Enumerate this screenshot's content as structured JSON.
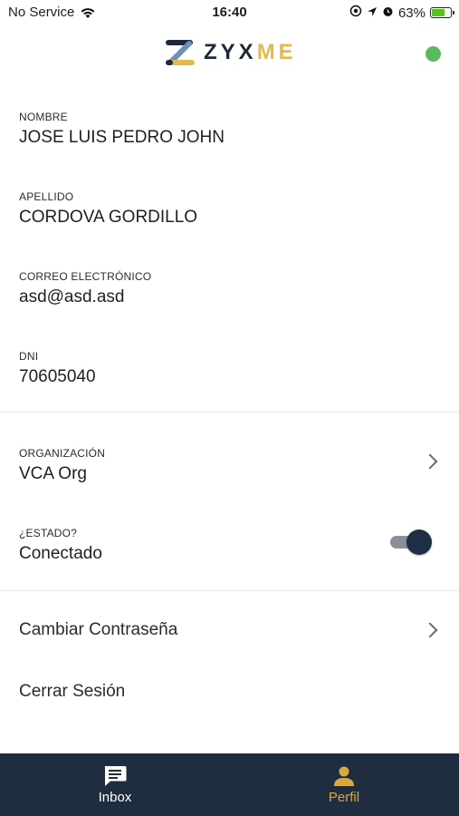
{
  "status_bar": {
    "carrier": "No Service",
    "time": "16:40",
    "battery": "63%"
  },
  "header": {
    "logo_text_left": "ZYX",
    "logo_text_right": "ME",
    "status_color": "#5cb85c"
  },
  "profile": {
    "nombre_label": "NOMBRE",
    "nombre_value": "JOSE LUIS PEDRO JOHN",
    "apellido_label": "APELLIDO",
    "apellido_value": "CORDOVA GORDILLO",
    "correo_label": "CORREO ELECTRÓNICO",
    "correo_value": "asd@asd.asd",
    "dni_label": "DNI",
    "dni_value": "70605040"
  },
  "organization": {
    "label": "ORGANIZACIÓN",
    "value": "VCA Org"
  },
  "estado": {
    "label": "¿ESTADO?",
    "value": "Conectado",
    "enabled": true
  },
  "actions": {
    "change_password": "Cambiar Contraseña",
    "logout": "Cerrar Sesión"
  },
  "bottom_nav": {
    "inbox_label": "Inbox",
    "perfil_label": "Perfil",
    "active": "Perfil",
    "active_color": "#d9a941",
    "bar_color": "#1e2d40"
  },
  "icons": [
    "wifi-icon",
    "location-icon",
    "alarm-icon",
    "battery-icon",
    "chevron-right-icon",
    "chat-icon",
    "person-icon"
  ]
}
